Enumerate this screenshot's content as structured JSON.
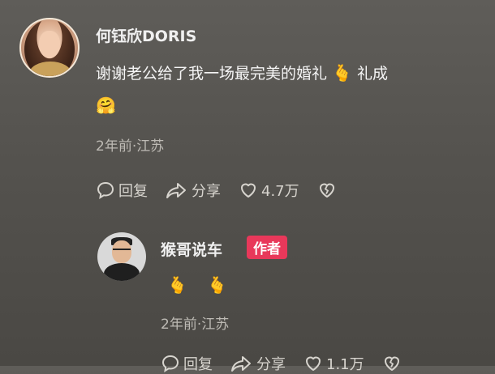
{
  "comment": {
    "username": "何钰欣DORIS",
    "text_line1": "谢谢老公给了我一场最完美的婚礼",
    "emoji_fingers": "🫰",
    "text_tail": "礼成",
    "emoji_hug": "🤗",
    "meta": "2年前·江苏",
    "actions": {
      "reply_label": "回复",
      "share_label": "分享",
      "like_count": "4.7万"
    }
  },
  "reply": {
    "username": "猴哥说车",
    "badge": "作者",
    "emojis": [
      "🫰",
      "🫰"
    ],
    "meta": "2年前·江苏",
    "actions": {
      "reply_label": "回复",
      "share_label": "分享",
      "like_count": "1.1万"
    }
  },
  "colors": {
    "background": "#56544f",
    "badge": "#e8385a",
    "meta_text": "#bdbab4"
  },
  "icons": [
    "comment-bubble-icon",
    "share-arrow-icon",
    "heart-icon",
    "broken-heart-icon"
  ]
}
